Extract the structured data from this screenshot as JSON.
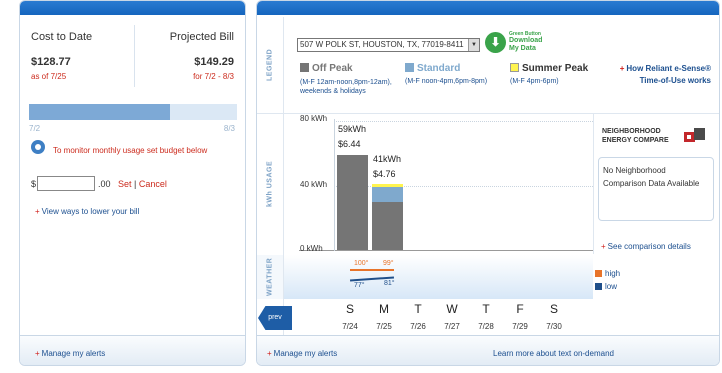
{
  "left": {
    "cost_to_date_label": "Cost to Date",
    "cost_to_date_value": "$128.77",
    "as_of": "as of 7/25",
    "projected_bill_label": "Projected Bill",
    "projected_bill_value": "$149.29",
    "projected_period": "for 7/2 - 8/3",
    "progress_fraction": 0.68,
    "progress_start": "7/2",
    "progress_end": "8/3",
    "budget_text": "To monitor monthly usage set budget below",
    "currency_symbol": "$",
    "budget_value": "",
    "budget_cents": ".00",
    "set_label": "Set",
    "separator": "|",
    "cancel_label": "Cancel",
    "lower_bill_link": "View ways to lower your bill",
    "manage_alerts": "Manage my alerts"
  },
  "right": {
    "address_select": "507 W POLK ST, HOUSTON, TX, 77019-8411",
    "green_button_line1": "Green Button",
    "green_button_line2": "Download",
    "green_button_line3": "My Data",
    "legend_side": "LEGEND",
    "usage_side": "kWh USAGE",
    "weather_side": "WEATHER",
    "legend": {
      "off_peak_label": "Off Peak",
      "off_peak_desc": "(M-F 12am-noon,8pm-12am), weekends & holidays",
      "standard_label": "Standard",
      "standard_desc": "(M-F noon-4pm,6pm-8pm)",
      "summer_label": "Summer Peak",
      "summer_desc": "(M-F 4pm-6pm)",
      "colors": {
        "off_peak": "#757575",
        "standard": "#7fa9cd",
        "summer": "#fff44f"
      }
    },
    "how_link_1": "How Reliant e-Sense®",
    "how_link_2": "Time-of-Use works",
    "y_ticks": [
      "80 kWh",
      "40 kWh",
      "0 kWh"
    ],
    "bar1_kwh": "59kWh",
    "bar1_cost": "$6.44",
    "bar2_kwh": "41kWh",
    "bar2_cost": "$4.76",
    "weather_high_1": "100°",
    "weather_high_2": "99°",
    "weather_low_1": "77°",
    "weather_low_2": "81°",
    "neighborhood_title_1": "NEIGHBORHOOD",
    "neighborhood_title_2": "ENERGY COMPARE",
    "no_comparison": "No Neighborhood Comparison Data Available",
    "see_comparison": "See comparison details",
    "high_label": "high",
    "low_label": "low",
    "high_color": "#e8742a",
    "low_color": "#1f4f8a",
    "prev_label": "prev",
    "days": [
      {
        "w": "S",
        "d": "7/24"
      },
      {
        "w": "M",
        "d": "7/25"
      },
      {
        "w": "T",
        "d": "7/26"
      },
      {
        "w": "W",
        "d": "7/27"
      },
      {
        "w": "T",
        "d": "7/28"
      },
      {
        "w": "F",
        "d": "7/29"
      },
      {
        "w": "S",
        "d": "7/30"
      }
    ],
    "manage_alerts": "Manage my alerts",
    "learn_more": "Learn more about text on-demand"
  },
  "chart_data": {
    "type": "bar",
    "categories": [
      "7/24",
      "7/25"
    ],
    "series": [
      {
        "name": "Off Peak",
        "values": [
          59,
          30
        ]
      },
      {
        "name": "Standard",
        "values": [
          0,
          9
        ]
      },
      {
        "name": "Summer Peak",
        "values": [
          0,
          2
        ]
      }
    ],
    "totals_kwh": [
      59,
      41
    ],
    "totals_cost": [
      "$6.44",
      "$4.76"
    ],
    "ylim": [
      0,
      80
    ]
  }
}
